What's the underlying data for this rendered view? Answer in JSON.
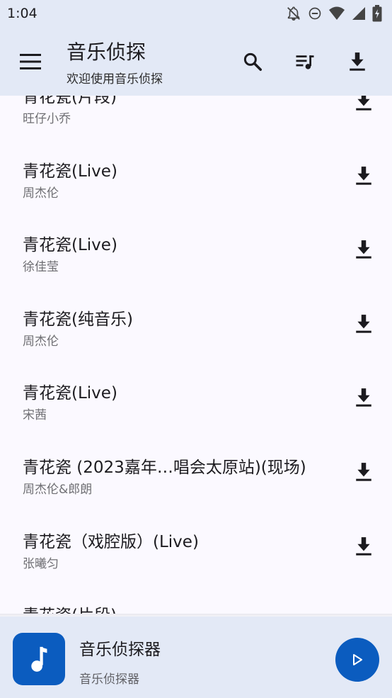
{
  "status_bar": {
    "time": "1:04",
    "icons": [
      "notifications-off-icon",
      "do-not-disturb-icon",
      "wifi-icon",
      "signal-icon",
      "battery-charging-icon"
    ]
  },
  "app_bar": {
    "title": "音乐侦探",
    "subtitle": "欢迎使用音乐侦探",
    "icons": [
      "menu-icon",
      "search-icon",
      "playlist-icon",
      "download-icon"
    ]
  },
  "songs": [
    {
      "title": "青花瓷(片段)",
      "artist": "旺仔小乔"
    },
    {
      "title": "青花瓷(Live)",
      "artist": "周杰伦"
    },
    {
      "title": "青花瓷(Live)",
      "artist": "徐佳莹"
    },
    {
      "title": "青花瓷(纯音乐)",
      "artist": "周杰伦"
    },
    {
      "title": "青花瓷(Live)",
      "artist": "宋茜"
    },
    {
      "title": "青花瓷 (2023嘉年…唱会太原站)(现场)",
      "artist": "周杰伦&郎朗"
    },
    {
      "title": "青花瓷（戏腔版）(Live)",
      "artist": "张曦匀"
    },
    {
      "title": "青花瓷(片段)",
      "artist": ""
    }
  ],
  "player": {
    "title": "音乐侦探器",
    "artist": "音乐侦探器",
    "accent_color": "#0b5cbf"
  }
}
